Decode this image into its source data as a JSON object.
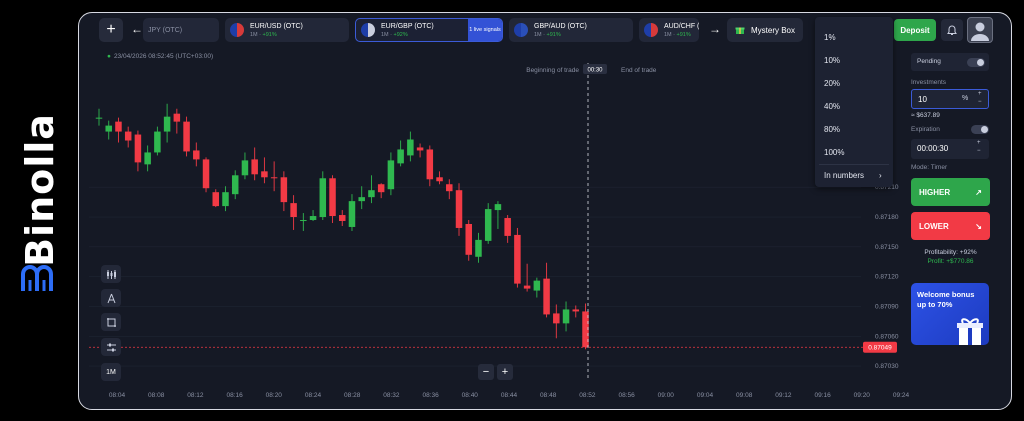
{
  "brand": {
    "name": "Binolla"
  },
  "topbar": {
    "add_label": "+",
    "back_label": "←",
    "forward_label": "→",
    "pairs": [
      {
        "name": "JPY (OTC)",
        "meta_prefix": "",
        "meta_pct": ""
      },
      {
        "name": "EUR/USD (OTC)",
        "meta_prefix": "1M · ",
        "meta_pct": "+91%"
      },
      {
        "name": "EUR/GBP (OTC)",
        "meta_prefix": "1M · ",
        "meta_pct": "+92%",
        "signals": "1 live signals"
      },
      {
        "name": "GBP/AUD (OTC)",
        "meta_prefix": "1M · ",
        "meta_pct": "+91%"
      },
      {
        "name": "AUD/CHF (OTC)",
        "meta_prefix": "1M · ",
        "meta_pct": "+91%"
      }
    ],
    "mystery_box": "Mystery Box",
    "deposit": "Deposit"
  },
  "chart_header": {
    "datetime": "23/04/2026  08:52:45  (UTC+03:00)"
  },
  "trade_markers": {
    "begin": "Beginning of trade",
    "end": "End of trade",
    "timer": "00:30"
  },
  "current_price": "0.87049",
  "timeframe": "1M",
  "zoom": {
    "minus": "−",
    "plus": "+"
  },
  "dropdown": {
    "items": [
      "1%",
      "10%",
      "20%",
      "40%",
      "80%",
      "100%"
    ],
    "in_numbers": "In numbers",
    "chevron": "›"
  },
  "panel": {
    "pending": "Pending",
    "investments_label": "Investments",
    "investment_value": "10",
    "investment_unit": "%",
    "investment_equiv": "≈ $637.89",
    "expiration_label": "Expiration",
    "expiration_value": "00:00:30",
    "mode": "Mode: Timer",
    "higher": "HIGHER",
    "higher_icon": "↗",
    "lower": "LOWER",
    "lower_icon": "↘",
    "profitability": "Profitability: +92%",
    "profit": "Profit: +$770.86"
  },
  "promo": {
    "text": "Welcome bonus up to 70%"
  },
  "colors": {
    "up": "#2fb84f",
    "down": "#f23a45",
    "accent": "#3352d6",
    "bg": "#151925"
  },
  "chart_data": {
    "type": "candlestick",
    "x_ticks": [
      "08:04",
      "08:08",
      "08:12",
      "08:16",
      "08:20",
      "08:24",
      "08:28",
      "08:32",
      "08:36",
      "08:40",
      "08:44",
      "08:48",
      "08:52",
      "08:56",
      "09:00",
      "09:04",
      "09:08",
      "09:12",
      "09:16",
      "09:20",
      "09:24"
    ],
    "y_ticks": [
      0.8721,
      0.8718,
      0.8715,
      0.8712,
      0.8709,
      0.8706,
      0.8703
    ],
    "ylim": [
      0.87015,
      0.87335
    ],
    "candles": [
      {
        "o": 0.8728,
        "c": 0.8728,
        "h": 0.87289,
        "l": 0.87272
      },
      {
        "o": 0.87266,
        "c": 0.87272,
        "h": 0.87277,
        "l": 0.87258
      },
      {
        "o": 0.87276,
        "c": 0.87266,
        "h": 0.8728,
        "l": 0.87255
      },
      {
        "o": 0.87266,
        "c": 0.87257,
        "h": 0.87271,
        "l": 0.8725
      },
      {
        "o": 0.87263,
        "c": 0.87235,
        "h": 0.87267,
        "l": 0.87226
      },
      {
        "o": 0.87233,
        "c": 0.87245,
        "h": 0.87252,
        "l": 0.87226
      },
      {
        "o": 0.87245,
        "c": 0.87266,
        "h": 0.87271,
        "l": 0.87242
      },
      {
        "o": 0.87266,
        "c": 0.87281,
        "h": 0.87294,
        "l": 0.87255
      },
      {
        "o": 0.87284,
        "c": 0.87276,
        "h": 0.87289,
        "l": 0.87264
      },
      {
        "o": 0.87276,
        "c": 0.87246,
        "h": 0.87281,
        "l": 0.87241
      },
      {
        "o": 0.87247,
        "c": 0.87238,
        "h": 0.87255,
        "l": 0.87231
      },
      {
        "o": 0.87238,
        "c": 0.87209,
        "h": 0.8724,
        "l": 0.87205
      },
      {
        "o": 0.87205,
        "c": 0.87191,
        "h": 0.87208,
        "l": 0.8719
      },
      {
        "o": 0.87191,
        "c": 0.87205,
        "h": 0.87211,
        "l": 0.87186
      },
      {
        "o": 0.87203,
        "c": 0.87222,
        "h": 0.87227,
        "l": 0.87198
      },
      {
        "o": 0.87222,
        "c": 0.87237,
        "h": 0.87245,
        "l": 0.87218
      },
      {
        "o": 0.87238,
        "c": 0.87223,
        "h": 0.8725,
        "l": 0.87217
      },
      {
        "o": 0.87226,
        "c": 0.8722,
        "h": 0.8724,
        "l": 0.87214
      },
      {
        "o": 0.8722,
        "c": 0.87219,
        "h": 0.87236,
        "l": 0.87206
      },
      {
        "o": 0.8722,
        "c": 0.87195,
        "h": 0.87226,
        "l": 0.87186
      },
      {
        "o": 0.87194,
        "c": 0.8718,
        "h": 0.87202,
        "l": 0.87167
      },
      {
        "o": 0.87177,
        "c": 0.87177,
        "h": 0.87184,
        "l": 0.87166
      },
      {
        "o": 0.87177,
        "c": 0.87181,
        "h": 0.87187,
        "l": 0.87176
      },
      {
        "o": 0.8718,
        "c": 0.87219,
        "h": 0.87226,
        "l": 0.87177
      },
      {
        "o": 0.87219,
        "c": 0.87181,
        "h": 0.87222,
        "l": 0.87174
      },
      {
        "o": 0.87182,
        "c": 0.87176,
        "h": 0.87187,
        "l": 0.87171
      },
      {
        "o": 0.8717,
        "c": 0.87196,
        "h": 0.87203,
        "l": 0.87166
      },
      {
        "o": 0.87196,
        "c": 0.872,
        "h": 0.87211,
        "l": 0.87188
      },
      {
        "o": 0.872,
        "c": 0.87207,
        "h": 0.87222,
        "l": 0.87194
      },
      {
        "o": 0.87213,
        "c": 0.87205,
        "h": 0.87214,
        "l": 0.87199
      },
      {
        "o": 0.87208,
        "c": 0.87237,
        "h": 0.87245,
        "l": 0.87202
      },
      {
        "o": 0.87234,
        "c": 0.87248,
        "h": 0.87257,
        "l": 0.87231
      },
      {
        "o": 0.87242,
        "c": 0.87258,
        "h": 0.87266,
        "l": 0.87236
      },
      {
        "o": 0.8725,
        "c": 0.87247,
        "h": 0.87254,
        "l": 0.8724
      },
      {
        "o": 0.87248,
        "c": 0.87218,
        "h": 0.87252,
        "l": 0.87211
      },
      {
        "o": 0.8722,
        "c": 0.87216,
        "h": 0.87226,
        "l": 0.87213
      },
      {
        "o": 0.87213,
        "c": 0.87206,
        "h": 0.87218,
        "l": 0.87198
      },
      {
        "o": 0.87207,
        "c": 0.87169,
        "h": 0.87214,
        "l": 0.87161
      },
      {
        "o": 0.87173,
        "c": 0.87142,
        "h": 0.87177,
        "l": 0.87136
      },
      {
        "o": 0.8714,
        "c": 0.87157,
        "h": 0.87164,
        "l": 0.87134
      },
      {
        "o": 0.87156,
        "c": 0.87188,
        "h": 0.87194,
        "l": 0.87153
      },
      {
        "o": 0.87187,
        "c": 0.87193,
        "h": 0.87196,
        "l": 0.87168
      },
      {
        "o": 0.87179,
        "c": 0.87161,
        "h": 0.87182,
        "l": 0.87154
      },
      {
        "o": 0.87162,
        "c": 0.87113,
        "h": 0.87169,
        "l": 0.87109
      },
      {
        "o": 0.87111,
        "c": 0.87108,
        "h": 0.87133,
        "l": 0.87105
      },
      {
        "o": 0.87106,
        "c": 0.87116,
        "h": 0.87119,
        "l": 0.87099
      },
      {
        "o": 0.87118,
        "c": 0.87082,
        "h": 0.87134,
        "l": 0.87079
      },
      {
        "o": 0.87083,
        "c": 0.87073,
        "h": 0.87092,
        "l": 0.87058
      },
      {
        "o": 0.87073,
        "c": 0.87087,
        "h": 0.87095,
        "l": 0.87065
      },
      {
        "o": 0.87087,
        "c": 0.87085,
        "h": 0.87091,
        "l": 0.87079
      },
      {
        "o": 0.87085,
        "c": 0.87049,
        "h": 0.87093,
        "l": 0.87047
      }
    ]
  }
}
